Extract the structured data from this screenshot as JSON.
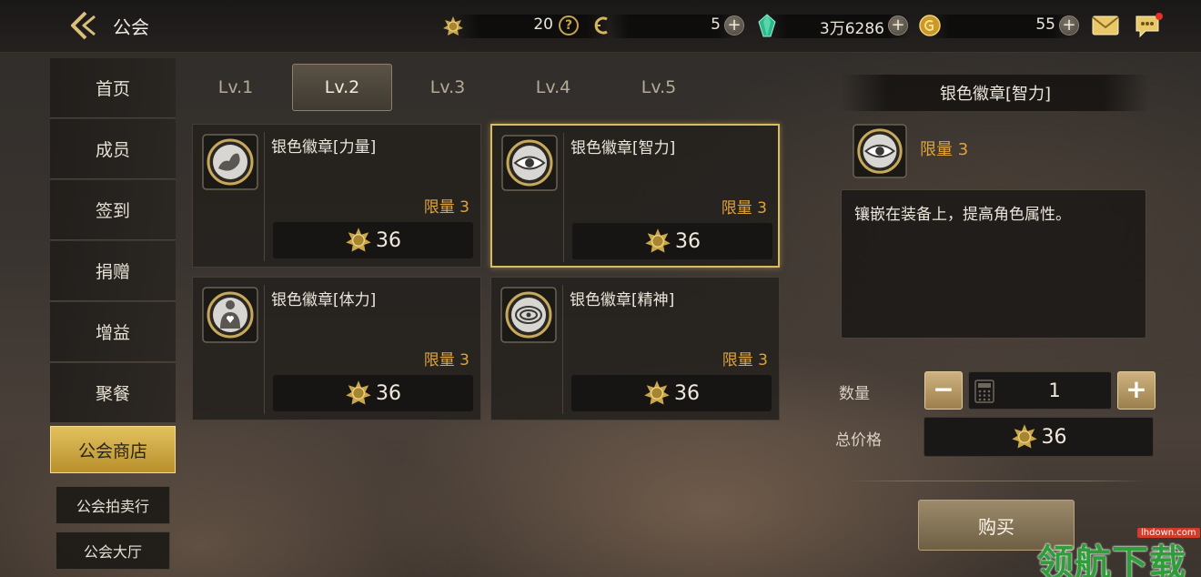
{
  "header": {
    "title": "公会",
    "resources": [
      {
        "name": "guild-badge-currency",
        "value": "20"
      },
      {
        "name": "activity-points",
        "value": "5"
      },
      {
        "name": "diamonds",
        "value": "3万6286"
      },
      {
        "name": "gold-coins",
        "value": "55"
      }
    ],
    "help_label": "?",
    "plus_label": "+"
  },
  "nav": {
    "items": [
      {
        "label": "首页"
      },
      {
        "label": "成员"
      },
      {
        "label": "签到"
      },
      {
        "label": "捐赠"
      },
      {
        "label": "增益"
      },
      {
        "label": "聚餐"
      },
      {
        "label": "公会商店"
      },
      {
        "label": "公会拍卖行"
      },
      {
        "label": "公会大厅"
      }
    ],
    "active_index": 6
  },
  "level_tabs": [
    {
      "label": "Lv.1"
    },
    {
      "label": "Lv.2"
    },
    {
      "label": "Lv.3"
    },
    {
      "label": "Lv.4"
    },
    {
      "label": "Lv.5"
    }
  ],
  "active_level": 1,
  "items": [
    {
      "name": "银色徽章[力量]",
      "limit": "限量 3",
      "price": "36",
      "icon": "strength-arm-icon"
    },
    {
      "name": "银色徽章[智力]",
      "limit": "限量 3",
      "price": "36",
      "icon": "intelligence-eye-icon"
    },
    {
      "name": "银色徽章[体力]",
      "limit": "限量 3",
      "price": "36",
      "icon": "stamina-heart-icon"
    },
    {
      "name": "银色徽章[精神]",
      "limit": "限量 3",
      "price": "36",
      "icon": "spirit-eye-icon"
    }
  ],
  "selected_item": 1,
  "detail": {
    "title": "银色徽章[智力]",
    "limit": "限量 3",
    "description": "镶嵌在装备上，提高角色属性。",
    "quantity_label": "数量",
    "quantity": "1",
    "minus_label": "−",
    "plus_label": "+",
    "total_label": "总价格",
    "total_price": "36",
    "buy_label": "购买"
  },
  "watermark": {
    "url": "lhdown.com",
    "text": "领航下载"
  },
  "colors": {
    "accent_gold": "#e0a43a",
    "active_nav": "#d4b04a",
    "watermark_green": "#2f9e3a"
  }
}
